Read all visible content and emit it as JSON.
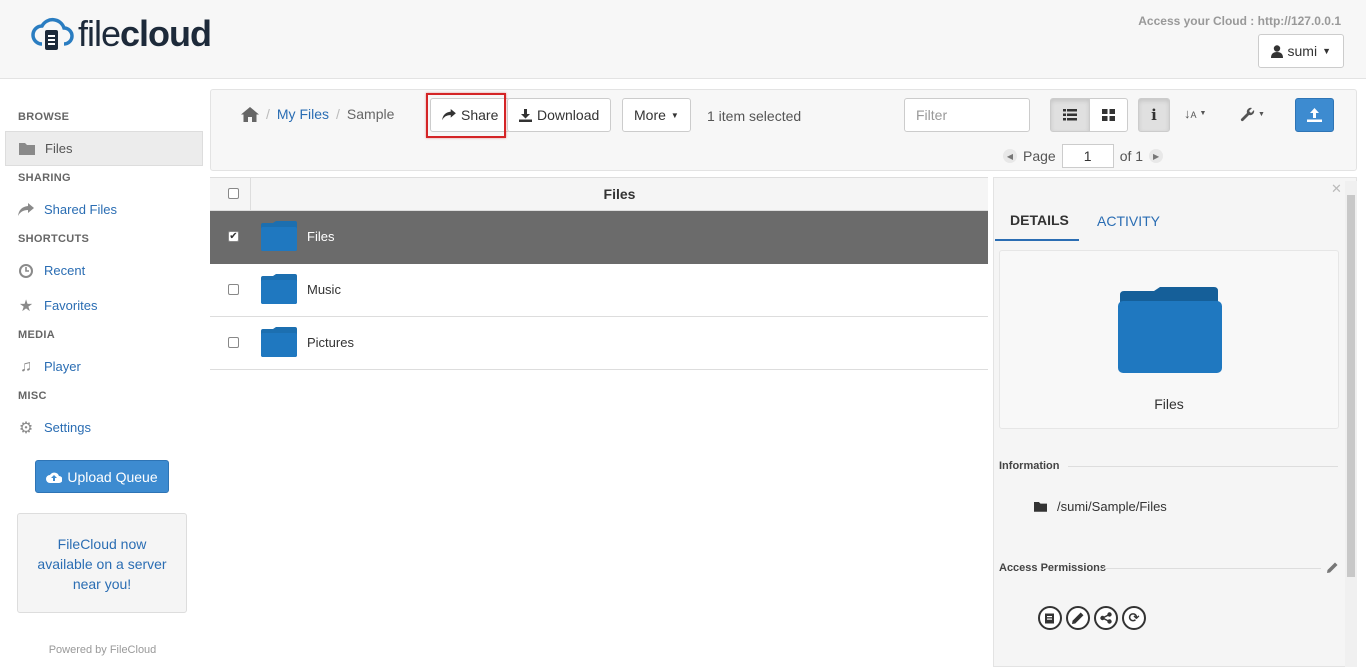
{
  "header": {
    "logo_file": "file",
    "logo_cloud": "cloud",
    "access_text": "Access your Cloud : http://127.0.0.1",
    "user_name": "sumi"
  },
  "sidebar": {
    "sections": {
      "browse": "BROWSE",
      "sharing": "SHARING",
      "shortcuts": "SHORTCUTS",
      "media": "MEDIA",
      "misc": "MISC"
    },
    "items": {
      "files": "Files",
      "shared_files": "Shared Files",
      "recent": "Recent",
      "favorites": "Favorites",
      "player": "Player",
      "settings": "Settings"
    },
    "upload_queue": "Upload Queue",
    "promo": [
      "FileCloud now",
      "available on a server",
      "near you!"
    ],
    "powered": "Powered by FileCloud"
  },
  "toolbar": {
    "breadcrumb": [
      "My Files",
      "Sample"
    ],
    "share": "Share",
    "download": "Download",
    "more": "More",
    "selected": "1 item selected",
    "filter_placeholder": "Filter",
    "page_label": "Page",
    "page_value": "1",
    "page_of": "of 1"
  },
  "list": {
    "header": "Files",
    "rows": [
      {
        "name": "Files",
        "checked": true
      },
      {
        "name": "Music",
        "checked": false
      },
      {
        "name": "Pictures",
        "checked": false
      }
    ]
  },
  "details": {
    "tab_details": "DETAILS",
    "tab_activity": "ACTIVITY",
    "preview_name": "Files",
    "information": "Information",
    "path": "/sumi/Sample/Files",
    "access_permissions": "Access Permissions"
  },
  "colors": {
    "accent": "#3d8bd0",
    "link": "#2a6db3",
    "folder": "#1c6fb0",
    "selected_row": "#6b6b6b",
    "highlight": "#d42426"
  }
}
